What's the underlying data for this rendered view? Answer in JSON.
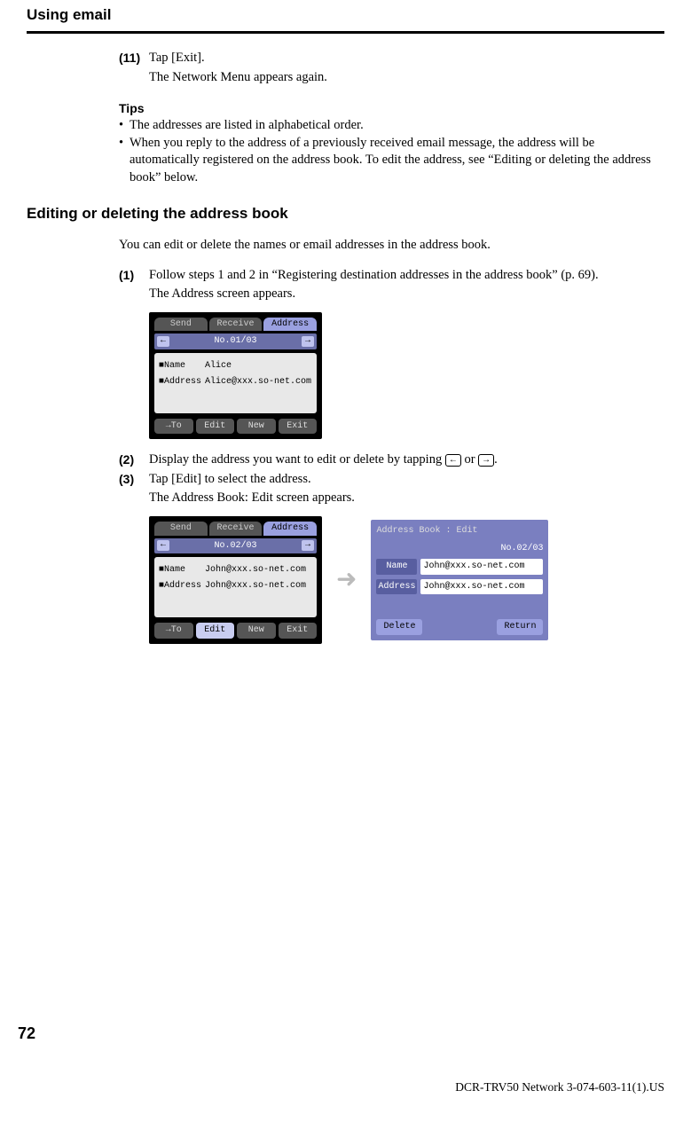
{
  "header": {
    "title": "Using email"
  },
  "step11": {
    "num": "(11)",
    "text": "Tap [Exit].",
    "after": "The Network Menu appears again."
  },
  "tips": {
    "heading": "Tips",
    "items": [
      "The addresses are listed in alphabetical order.",
      "When you reply to the address of a previously received email message, the address will be automatically registered on the address book. To edit the address, see “Editing or deleting the address book” below."
    ]
  },
  "h2": "Editing or deleting the address book",
  "intro": "You can edit or delete the names or email addresses in the address book.",
  "step1": {
    "num": "(1)",
    "text": "Follow steps 1 and 2 in “Registering destination addresses in the address book” (p. 69).",
    "after": "The Address screen appears."
  },
  "shot1": {
    "tabs": [
      "Send",
      "Receive",
      "Address"
    ],
    "counter": "No.01/03",
    "name_label": "■Name",
    "name_value": "Alice",
    "addr_label": "■Address",
    "addr_value": "Alice@xxx.so-net.com",
    "buttons": [
      "→To",
      "Edit",
      "New",
      "Exit"
    ]
  },
  "step2": {
    "num": "(2)",
    "text_before": "Display the address you want to edit or delete by tapping ",
    "text_mid": " or ",
    "text_after": "."
  },
  "step3": {
    "num": "(3)",
    "text": "Tap [Edit] to select the address.",
    "after": "The Address Book: Edit screen appears."
  },
  "shot2": {
    "tabs": [
      "Send",
      "Receive",
      "Address"
    ],
    "counter": "No.02/03",
    "name_label": "■Name",
    "name_value": "John@xxx.so-net.com",
    "addr_label": "■Address",
    "addr_value": "John@xxx.so-net.com",
    "buttons": [
      "→To",
      "Edit",
      "New",
      "Exit"
    ]
  },
  "shot3": {
    "header": "Address Book : Edit",
    "counter": "No.02/03",
    "name_label": "Name",
    "name_value": "John@xxx.so-net.com",
    "addr_label": "Address",
    "addr_value": "John@xxx.so-net.com",
    "delete": "Delete",
    "return": "Return"
  },
  "icons": {
    "left": "←",
    "right": "→"
  },
  "page_number": "72",
  "footer": "DCR-TRV50 Network 3-074-603-11(1).US"
}
